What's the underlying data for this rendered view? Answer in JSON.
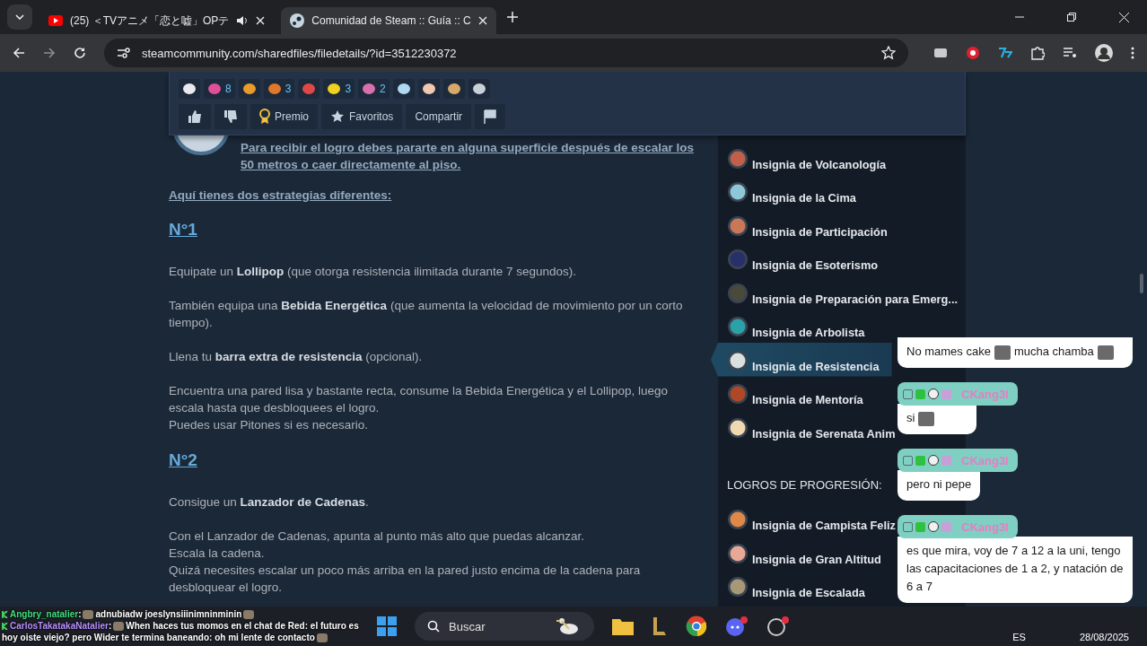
{
  "browser": {
    "tabs": [
      {
        "title": "(25) ＜TVアニメ「恋と嘘」OPテ",
        "selected": false,
        "audio": true
      },
      {
        "title": "Comunidad de Steam :: Guía :: C",
        "selected": true,
        "audio": false
      }
    ],
    "url": "steamcommunity.com/sharedfiles/filedetails/?id=3512230372"
  },
  "awards": [
    {
      "color": "#e8e8f0"
    },
    {
      "color": "#e0509a",
      "count": "8"
    },
    {
      "color": "#e89a2a"
    },
    {
      "color": "#e0772a",
      "count": "3"
    },
    {
      "color": "#e04848"
    },
    {
      "color": "#f0d020",
      "count": "3"
    },
    {
      "color": "#d870b0",
      "count": "2"
    },
    {
      "color": "#b0d8f0"
    },
    {
      "color": "#f0c8b0"
    },
    {
      "color": "#d8a868"
    },
    {
      "color": "#c8d0d8"
    }
  ],
  "actions": [
    {
      "kind": "thumbs-up"
    },
    {
      "kind": "thumbs-down"
    },
    {
      "kind": "award",
      "label": "Premio"
    },
    {
      "kind": "star",
      "label": "Favoritos"
    },
    {
      "kind": "plain",
      "label": "Compartir"
    },
    {
      "kind": "flag"
    }
  ],
  "guide": {
    "intro": "Para recibir el logro debes pararte en alguna superficie después de escalar los 50 metros o caer directamente al piso.",
    "lead": "Aquí tienes dos estrategias diferentes:",
    "sections": [
      {
        "heading": "N°1",
        "paragraphs": [
          [
            "Equipate un **Lollipop** (que otorga resistencia ilimitada durante 7 segundos)."
          ],
          [
            "También equipa una **Bebida Energética** (que aumenta la velocidad de movimiento por un corto tiempo)."
          ],
          [
            "Llena tu **barra extra de resistencia** (opcional)."
          ],
          [
            "Encuentra una pared lisa y bastante recta, consume la Bebida Energética y el Lollipop, luego escala hasta que desbloquees el logro.",
            "Puedes usar Pitones si es necesario."
          ]
        ]
      },
      {
        "heading": "N°2",
        "paragraphs": [
          [
            "Consigue un **Lanzador de Cadenas**."
          ],
          [
            "Con el Lanzador de Cadenas, apunta al punto más alto que puedas alcanzar.",
            "Escala la cadena.",
            "Quizá necesites escalar un poco más arriba en la pared justo encima de la cadena para desbloquear el logro."
          ]
        ]
      }
    ]
  },
  "sidebar": {
    "groups": [
      {
        "items": [
          {
            "label": "Insignia de Volcanología",
            "color": "#c0604a",
            "selected": false
          },
          {
            "label": "Insignia de la Cima",
            "color": "#8ec8d8",
            "selected": false
          },
          {
            "label": "Insignia de Participación",
            "color": "#c87858",
            "selected": false
          },
          {
            "label": "Insignia de Esoterismo",
            "color": "#28306a",
            "selected": false
          },
          {
            "label": "Insignia de Preparación para Emerg...",
            "color": "#4a4a3a",
            "selected": false
          },
          {
            "label": "Insignia de Arbolista",
            "color": "#2aa0a8",
            "selected": false
          },
          {
            "label": "Insignia de Resistencia",
            "color": "#d8e0e0",
            "selected": true
          },
          {
            "label": "Insignia de Mentoría",
            "color": "#b04828",
            "selected": false
          },
          {
            "label": "Insignia de Serenata Anim",
            "color": "#f0d8b0",
            "selected": false
          }
        ]
      },
      {
        "heading": "LOGROS DE PROGRESIÓN:",
        "items": [
          {
            "label": "Insignia de Campista Feliz",
            "color": "#e08848",
            "selected": false
          },
          {
            "label": "Insignia de Gran Altitud",
            "color": "#e8a898",
            "selected": false
          },
          {
            "label": "Insignia de Escalada",
            "color": "#a89878",
            "selected": false
          }
        ]
      }
    ]
  },
  "chat": [
    {
      "parts": [
        {
          "kind": "text",
          "text": "No mames cake"
        },
        {
          "kind": "emote"
        },
        {
          "kind": "text",
          "text": "mucha chamba"
        },
        {
          "kind": "emote"
        }
      ]
    },
    {
      "user": "CKang3l",
      "parts": [
        {
          "kind": "text",
          "text": "si"
        },
        {
          "kind": "emote"
        }
      ]
    },
    {
      "user": "CKang3l",
      "parts": [
        {
          "kind": "text",
          "text": "pero ni pepe"
        }
      ]
    },
    {
      "user": "CKang3l",
      "parts": [
        {
          "kind": "text",
          "text": "es que mira, voy de 7 a 12 a la uni, tengo las capacitaciones de 1 a 2, y natación de 6 a 7"
        }
      ]
    }
  ],
  "stream_chat": [
    {
      "user": "Angbry_natalier",
      "color": "#40e080",
      "separator": ":",
      "text": "adnubiadw joeslynsiiinimninminin"
    },
    {
      "user": "CarlosTakatakaNatalier",
      "color": "#b890ff",
      "separator": ":",
      "text": "When haces tus momos en el chat de Red: el futuro es hoy oiste viejo? pero Wider te termina baneando: oh mi lente de contacto"
    }
  ],
  "taskbar": {
    "search": "Buscar",
    "language": "ES",
    "date": "28/08/2025"
  }
}
